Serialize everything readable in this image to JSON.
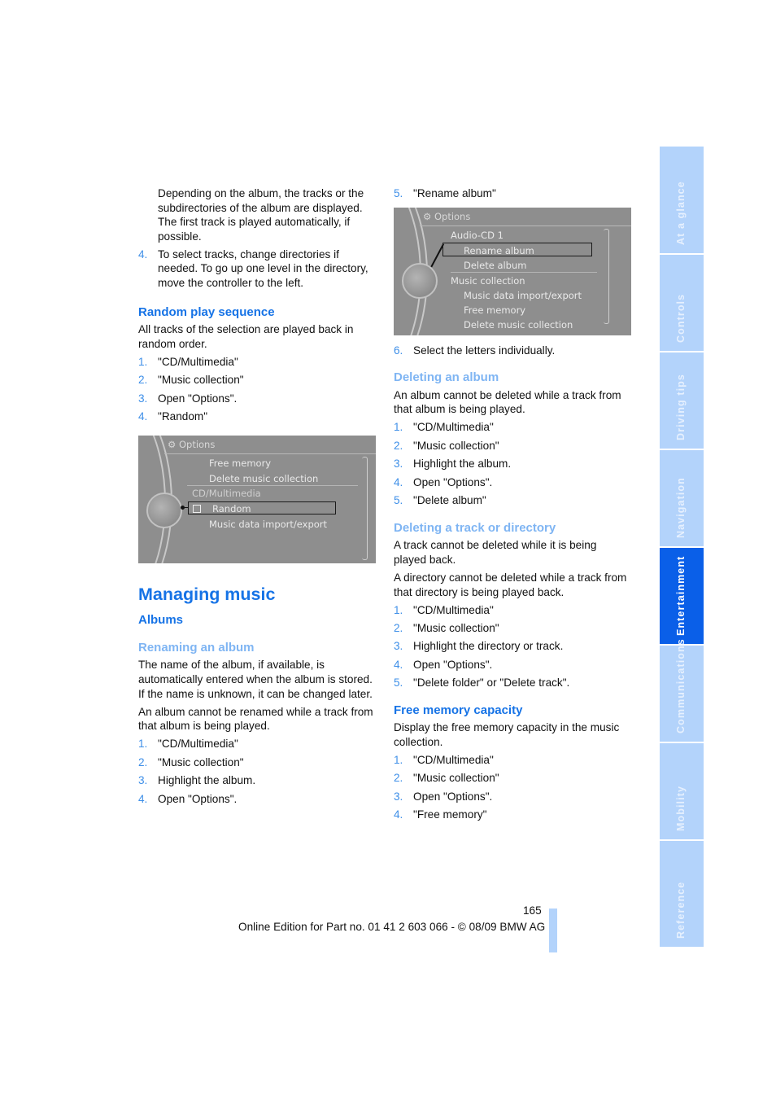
{
  "left_column": {
    "intro_paragraph": "Depending on the album, the tracks or the subdirectories of the album are displayed. The first track is played automatically, if possible.",
    "step4": {
      "num": "4.",
      "text": "To select tracks, change directories if needed. To go up one level in the directory, move the controller to the left."
    },
    "random_play": {
      "heading": "Random play sequence",
      "description": "All tracks of the selection are played back in random order.",
      "steps": [
        {
          "num": "1.",
          "text": "\"CD/Multimedia\""
        },
        {
          "num": "2.",
          "text": "\"Music collection\""
        },
        {
          "num": "3.",
          "text": "Open \"Options\"."
        },
        {
          "num": "4.",
          "text": "\"Random\""
        }
      ],
      "screen": {
        "header": "Options",
        "items": [
          "Free memory",
          "Delete music collection",
          "CD/Multimedia",
          "Random",
          "Music data import/export"
        ],
        "selected_item": "Random"
      }
    },
    "managing_music": {
      "heading": "Managing music",
      "subheading": "Albums",
      "renaming": {
        "heading": "Renaming an album",
        "paragraph1": "The name of the album, if available, is automatically entered when the album is stored. If the name is unknown, it can be changed later.",
        "paragraph2": "An album cannot be renamed while a track from that album is being played.",
        "steps": [
          {
            "num": "1.",
            "text": "\"CD/Multimedia\""
          },
          {
            "num": "2.",
            "text": "\"Music collection\""
          },
          {
            "num": "3.",
            "text": "Highlight the album."
          },
          {
            "num": "4.",
            "text": "Open \"Options\"."
          }
        ]
      }
    }
  },
  "right_column": {
    "rename_steps_cont": [
      {
        "num": "5.",
        "text": "\"Rename album\""
      }
    ],
    "screen": {
      "header": "Options",
      "items": [
        "Audio-CD 1",
        "Rename album",
        "Delete album",
        "Music collection",
        "Music data import/export",
        "Free memory",
        "Delete music collection"
      ],
      "selected_item": "Rename album"
    },
    "rename_step6": {
      "num": "6.",
      "text": "Select the letters individually."
    },
    "deleting_album": {
      "heading": "Deleting an album",
      "description": "An album cannot be deleted while a track from that album is being played.",
      "steps": [
        {
          "num": "1.",
          "text": "\"CD/Multimedia\""
        },
        {
          "num": "2.",
          "text": "\"Music collection\""
        },
        {
          "num": "3.",
          "text": "Highlight the album."
        },
        {
          "num": "4.",
          "text": "Open \"Options\"."
        },
        {
          "num": "5.",
          "text": "\"Delete album\""
        }
      ]
    },
    "deleting_track": {
      "heading": "Deleting a track or directory",
      "paragraph1": "A track cannot be deleted while it is being played back.",
      "paragraph2": "A directory cannot be deleted while a track from that directory is being played back.",
      "steps": [
        {
          "num": "1.",
          "text": "\"CD/Multimedia\""
        },
        {
          "num": "2.",
          "text": "\"Music collection\""
        },
        {
          "num": "3.",
          "text": "Highlight the directory or track."
        },
        {
          "num": "4.",
          "text": "Open \"Options\"."
        },
        {
          "num": "5.",
          "text": "\"Delete folder\" or \"Delete track\"."
        }
      ]
    },
    "free_memory": {
      "heading": "Free memory capacity",
      "description": "Display the free memory capacity in the music collection.",
      "steps": [
        {
          "num": "1.",
          "text": "\"CD/Multimedia\""
        },
        {
          "num": "2.",
          "text": "\"Music collection\""
        },
        {
          "num": "3.",
          "text": "Open \"Options\"."
        },
        {
          "num": "4.",
          "text": "\"Free memory\""
        }
      ]
    }
  },
  "side_tabs": [
    {
      "label": "At a glance",
      "active": false
    },
    {
      "label": "Controls",
      "active": false
    },
    {
      "label": "Driving tips",
      "active": false
    },
    {
      "label": "Navigation",
      "active": false
    },
    {
      "label": "Entertainment",
      "active": true
    },
    {
      "label": "Communications",
      "active": false
    },
    {
      "label": "Mobility",
      "active": false
    },
    {
      "label": "Reference",
      "active": false
    }
  ],
  "footer": {
    "page_number": "165",
    "edition_text": "Online Edition for Part no. 01 41 2 603 066 - © 08/09 BMW AG"
  },
  "colors": {
    "heading_blue": "#1673e6",
    "subheading_light_blue": "#7fb5f3",
    "step_number_blue": "#3e8fe8",
    "tab_inactive": "#b3d3fb",
    "tab_active": "#0a5fe8",
    "screen_gray": "#8e8e8e"
  }
}
